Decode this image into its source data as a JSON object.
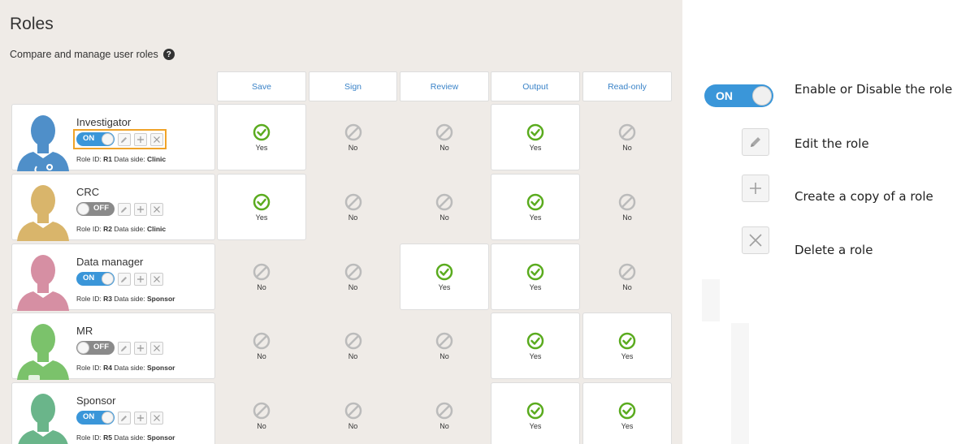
{
  "header": {
    "title": "Roles",
    "subtitle": "Compare and manage user roles",
    "help_icon": "question-circle-icon"
  },
  "columns": [
    "Save",
    "Sign",
    "Review",
    "Output",
    "Read-only"
  ],
  "labels": {
    "yes": "Yes",
    "no": "No",
    "role_id": "Role ID:",
    "data_side": "Data side:"
  },
  "toggle": {
    "on": "ON",
    "off": "OFF"
  },
  "roles": [
    {
      "name": "Investigator",
      "id": "R1",
      "side": "Clinic",
      "enabled": true,
      "avatar_color": "#4f8fc9",
      "permissions": [
        true,
        false,
        false,
        true,
        false
      ]
    },
    {
      "name": "CRC",
      "id": "R2",
      "side": "Clinic",
      "enabled": false,
      "avatar_color": "#d9b56b",
      "permissions": [
        true,
        false,
        false,
        true,
        false
      ]
    },
    {
      "name": "Data manager",
      "id": "R3",
      "side": "Sponsor",
      "enabled": true,
      "avatar_color": "#d68fa3",
      "permissions": [
        false,
        false,
        true,
        true,
        false
      ]
    },
    {
      "name": "MR",
      "id": "R4",
      "side": "Sponsor",
      "enabled": false,
      "avatar_color": "#7bc26b",
      "permissions": [
        false,
        false,
        false,
        true,
        true
      ]
    },
    {
      "name": "Sponsor",
      "id": "R5",
      "side": "Sponsor",
      "enabled": true,
      "avatar_color": "#6ab58a",
      "permissions": [
        false,
        false,
        false,
        true,
        true
      ]
    }
  ],
  "legend": {
    "toggle_label": "ON",
    "toggle_text": "Enable or Disable the role",
    "edit_text": "Edit the role",
    "copy_text": "Create a copy of a role",
    "delete_text": "Delete a role",
    "edit_icon": "pencil-icon",
    "copy_icon": "plus-icon",
    "delete_icon": "close-icon"
  },
  "colors": {
    "accent": "#3a96d9",
    "check": "#5aab1e",
    "ban": "#bbbbbb",
    "highlight": "#f0a329",
    "panel_bg": "#efebe7"
  }
}
